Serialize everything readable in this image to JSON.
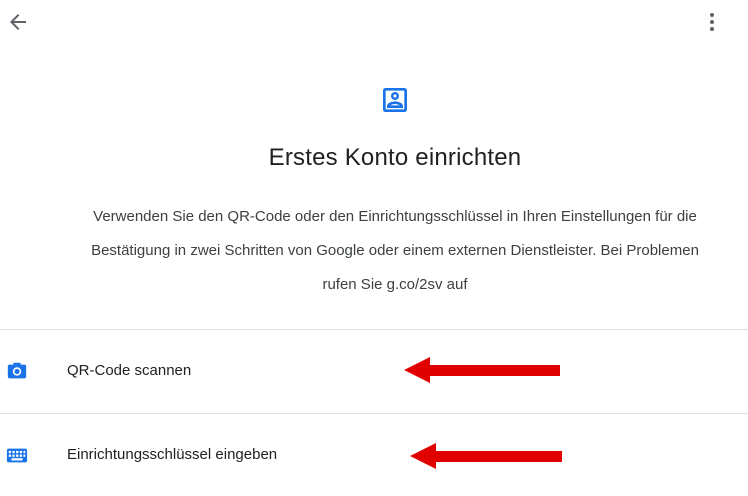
{
  "header": {
    "back_icon": "arrow-back-icon",
    "menu_icon": "more-vert-icon"
  },
  "main": {
    "hero_icon": "account-box-icon",
    "title": "Erstes Konto einrichten",
    "description_lines": [
      "Verwenden Sie den QR-Code oder den Einrichtungsschlüssel in Ihren Einstellungen für die",
      "Bestätigung in zwei Schritten von Google oder einem externen Dienstleister. Bei Problemen",
      "rufen Sie g.co/2sv auf"
    ]
  },
  "options": [
    {
      "label": "QR-Code scannen",
      "icon": "camera-icon"
    },
    {
      "label": "Einrichtungsschlüssel eingeben",
      "icon": "keyboard-icon"
    }
  ],
  "annotations": {
    "arrow_color": "#e00000"
  },
  "colors": {
    "accent": "#1a73e8",
    "divider": "#e0e0e0",
    "icon_gray": "#5f6368"
  }
}
